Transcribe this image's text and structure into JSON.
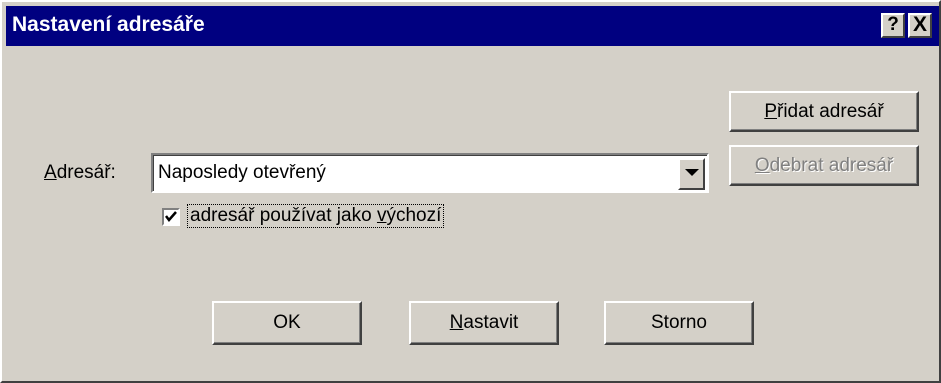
{
  "window": {
    "title": "Nastavení adresáře",
    "help_label": "?",
    "close_label": "X"
  },
  "buttons": {
    "add_prefix": "",
    "add_mnemonic": "P",
    "add_rest": "řidat adresář",
    "remove_prefix": "",
    "remove_mnemonic": "O",
    "remove_rest": "debrat adresář",
    "ok": "OK",
    "set_prefix": "",
    "set_mnemonic": "N",
    "set_rest": "astavit",
    "cancel": "Storno"
  },
  "directory": {
    "label_mnemonic": "A",
    "label_rest": "dresář:",
    "selected": "Naposledy otevřený"
  },
  "default_checkbox": {
    "label_prefix": "adresář používat jako ",
    "label_mnemonic": "v",
    "label_rest": "ýchozí",
    "checked": true
  },
  "icons": {
    "dropdown": "chevron-down-icon",
    "check": "checkmark-icon"
  }
}
